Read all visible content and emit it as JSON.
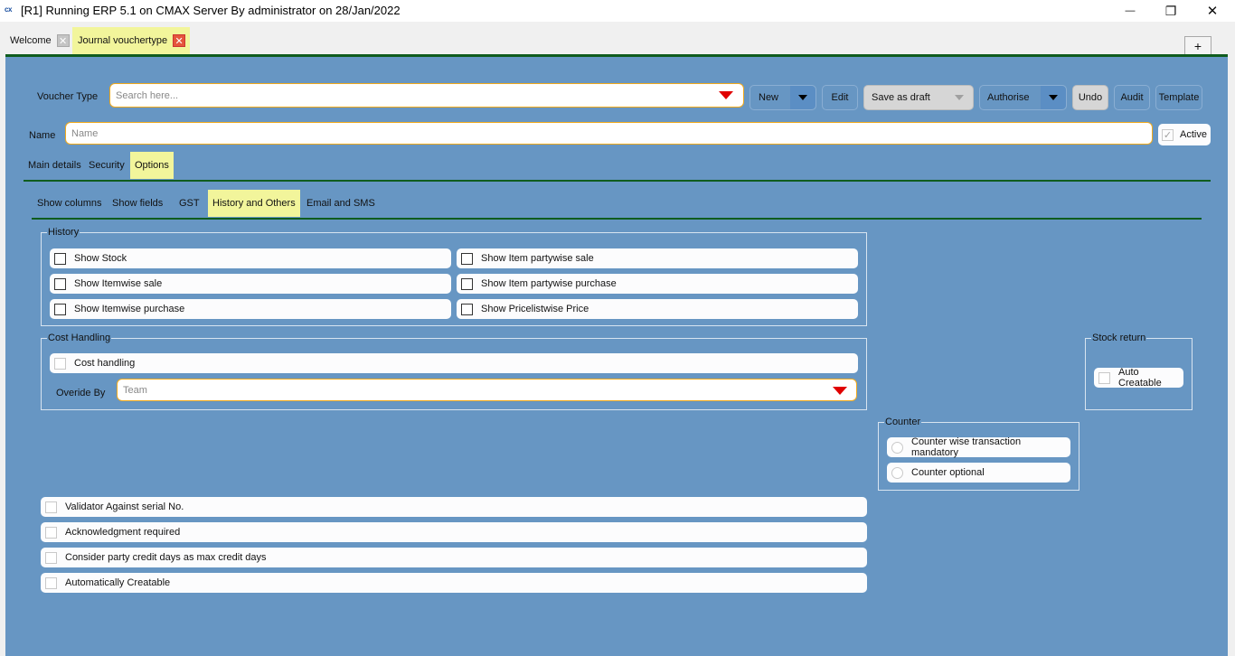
{
  "window": {
    "app_icon": "cx",
    "title": "[R1] Running ERP 5.1 on CMAX Server By administrator on 28/Jan/2022",
    "controls": {
      "minimize": "—",
      "restore": "❐",
      "close": "✕"
    }
  },
  "doc_tabs": [
    {
      "label": "Welcome",
      "active": false,
      "close": "✕"
    },
    {
      "label": "Journal vouchertype",
      "active": true,
      "close": "✕"
    }
  ],
  "add_tab": "+",
  "toolbar": {
    "voucher_type_label": "Voucher Type",
    "voucher_type_placeholder": "Search here...",
    "new": "New",
    "edit": "Edit",
    "save_as_draft": "Save as draft",
    "authorise": "Authorise",
    "undo": "Undo",
    "audit": "Audit",
    "template": "Template"
  },
  "name_field": {
    "label": "Name",
    "placeholder": "Name",
    "active_label": "Active",
    "active_checked": true
  },
  "main_tabs": [
    {
      "label": "Main details",
      "active": false
    },
    {
      "label": "Security",
      "active": false
    },
    {
      "label": "Options",
      "active": true
    }
  ],
  "sub_tabs": [
    {
      "label": "Show columns",
      "active": false
    },
    {
      "label": "Show fields",
      "active": false
    },
    {
      "label": "GST",
      "active": false
    },
    {
      "label": "History and Others",
      "active": true
    },
    {
      "label": "Email and SMS",
      "active": false
    }
  ],
  "history": {
    "title": "History",
    "left": [
      {
        "label": "Show Stock",
        "checked": false
      },
      {
        "label": "Show Itemwise sale",
        "checked": false
      },
      {
        "label": "Show Itemwise purchase",
        "checked": false
      }
    ],
    "right": [
      {
        "label": "Show Item partywise sale",
        "checked": false
      },
      {
        "label": "Show Item partywise purchase",
        "checked": false
      },
      {
        "label": "Show Pricelistwise Price",
        "checked": false
      }
    ]
  },
  "cost_handling": {
    "title": "Cost Handling",
    "checkbox_label": "Cost handling",
    "checked": false,
    "override_label": "Overide By",
    "override_placeholder": "Team"
  },
  "stock_return": {
    "title": "Stock return",
    "checkbox_label": "Auto Creatable",
    "checked": false
  },
  "counter": {
    "title": "Counter",
    "options": [
      {
        "label": "Counter wise transaction mandatory",
        "selected": false
      },
      {
        "label": "Counter optional",
        "selected": false
      }
    ]
  },
  "others": [
    {
      "label": "Validator Against serial No.",
      "checked": false
    },
    {
      "label": "Acknowledgment required",
      "checked": false
    },
    {
      "label": "Consider party credit days as max credit days",
      "checked": false
    },
    {
      "label": "Automatically Creatable",
      "checked": false
    }
  ],
  "colors": {
    "panel": "#6796c3",
    "active_tab": "#f2f59b",
    "input_border": "#f0a91c",
    "dropdown_arrow": "#e00000",
    "divider": "#0f5c1e"
  }
}
